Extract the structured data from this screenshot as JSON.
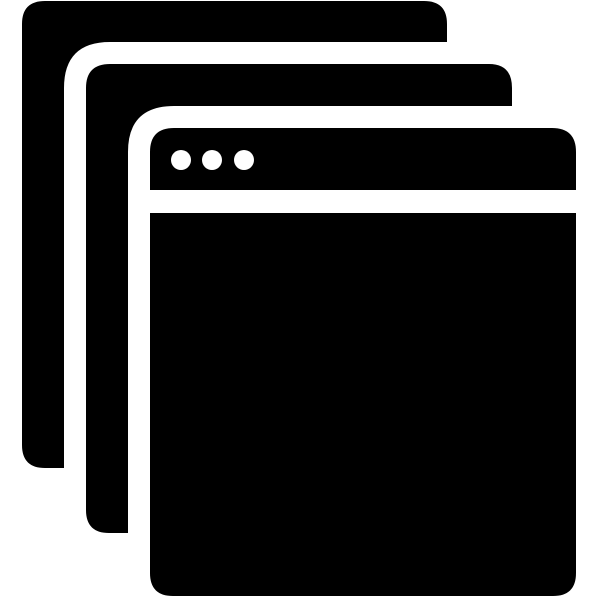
{
  "icon": {
    "name": "multiple-browser-windows-icon",
    "colors": {
      "fill": "#000000",
      "background": "#ffffff"
    },
    "window_count": 3,
    "title_bar_dot_count": 3
  }
}
